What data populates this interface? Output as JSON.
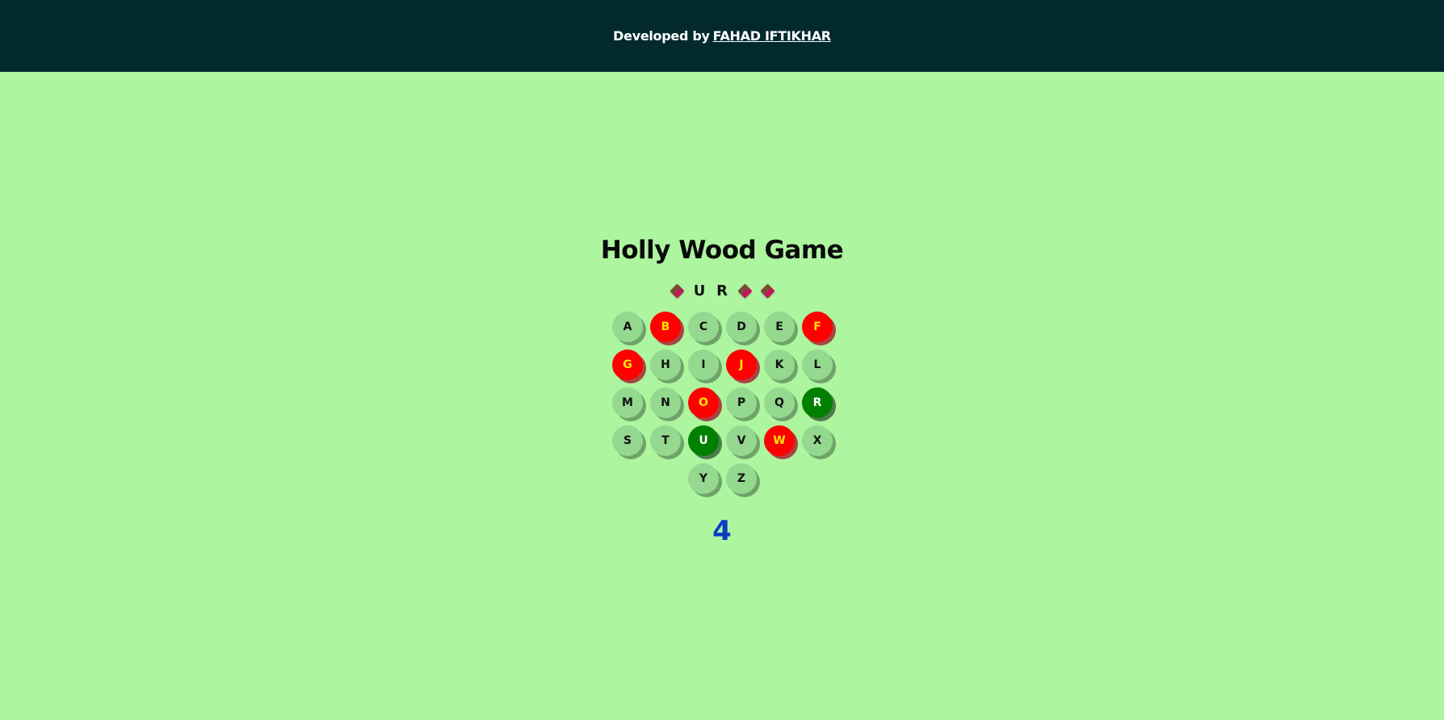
{
  "header": {
    "prefix": "Developed by",
    "author": "FAHAD IFTIKHAR"
  },
  "game": {
    "title": "Holly Wood Game",
    "word_slots": [
      {
        "letter": "",
        "hidden": true
      },
      {
        "letter": "U",
        "hidden": false
      },
      {
        "letter": "R",
        "hidden": false
      },
      {
        "letter": "",
        "hidden": true
      },
      {
        "letter": "",
        "hidden": true
      }
    ],
    "blank_icon": "chocolate-bar-icon",
    "keys": [
      {
        "letter": "A",
        "state": "unused"
      },
      {
        "letter": "B",
        "state": "wrong"
      },
      {
        "letter": "C",
        "state": "unused"
      },
      {
        "letter": "D",
        "state": "unused"
      },
      {
        "letter": "E",
        "state": "unused"
      },
      {
        "letter": "F",
        "state": "wrong"
      },
      {
        "letter": "G",
        "state": "wrong"
      },
      {
        "letter": "H",
        "state": "unused"
      },
      {
        "letter": "I",
        "state": "unused"
      },
      {
        "letter": "J",
        "state": "wrong"
      },
      {
        "letter": "K",
        "state": "unused"
      },
      {
        "letter": "L",
        "state": "unused"
      },
      {
        "letter": "M",
        "state": "unused"
      },
      {
        "letter": "N",
        "state": "unused"
      },
      {
        "letter": "O",
        "state": "wrong"
      },
      {
        "letter": "P",
        "state": "unused"
      },
      {
        "letter": "Q",
        "state": "unused"
      },
      {
        "letter": "R",
        "state": "correct"
      },
      {
        "letter": "S",
        "state": "unused"
      },
      {
        "letter": "T",
        "state": "unused"
      },
      {
        "letter": "U",
        "state": "correct"
      },
      {
        "letter": "V",
        "state": "unused"
      },
      {
        "letter": "W",
        "state": "wrong"
      },
      {
        "letter": "X",
        "state": "unused"
      },
      {
        "letter": "Y",
        "state": "unused"
      },
      {
        "letter": "Z",
        "state": "unused"
      }
    ],
    "lives_remaining": "4"
  },
  "colors": {
    "background": "#adf59f",
    "header_bg": "#02292e",
    "key_default": "#95d88f",
    "key_wrong": "#ff0000",
    "key_wrong_text": "#ffe600",
    "key_correct": "#008000",
    "lives_text": "#0a3fc4"
  }
}
